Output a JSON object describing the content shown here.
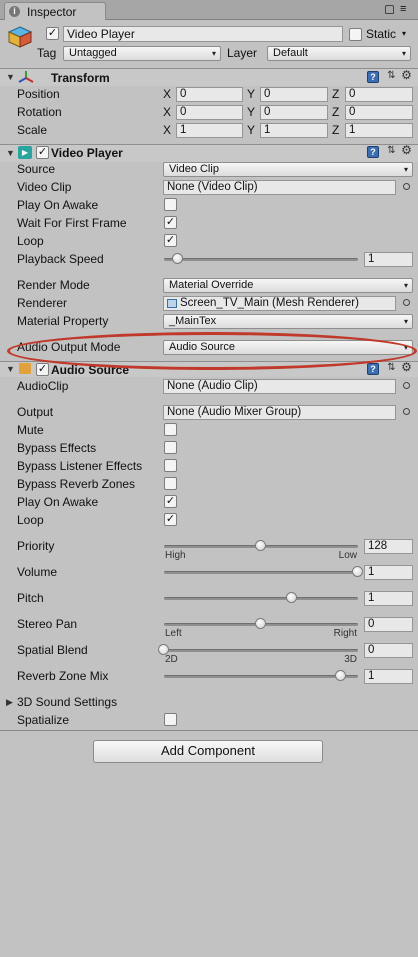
{
  "window": {
    "tab_label": "Inspector",
    "lock_icon": "lock-icon",
    "menu_icon": "menu-icon"
  },
  "object": {
    "name": "Video Player",
    "static_label": "Static",
    "tag_label": "Tag",
    "tag_value": "Untagged",
    "layer_label": "Layer",
    "layer_value": "Default"
  },
  "transform": {
    "title": "Transform",
    "rows": [
      {
        "label": "Position",
        "x": "0",
        "y": "0",
        "z": "0"
      },
      {
        "label": "Rotation",
        "x": "0",
        "y": "0",
        "z": "0"
      },
      {
        "label": "Scale",
        "x": "1",
        "y": "1",
        "z": "1"
      }
    ],
    "axis": {
      "x": "X",
      "y": "Y",
      "z": "Z"
    }
  },
  "video_player": {
    "title": "Video Player",
    "source_label": "Source",
    "source_value": "Video Clip",
    "video_clip_label": "Video Clip",
    "video_clip_value": "None (Video Clip)",
    "play_on_awake_label": "Play On Awake",
    "play_on_awake": false,
    "wait_label": "Wait For First Frame",
    "wait": true,
    "loop_label": "Loop",
    "loop": true,
    "speed_label": "Playback Speed",
    "speed_value": "1",
    "speed_level": 0.07,
    "render_mode_label": "Render Mode",
    "render_mode_value": "Material Override",
    "renderer_label": "Renderer",
    "renderer_value": "Screen_TV_Main (Mesh Renderer)",
    "material_property_label": "Material Property",
    "material_property_value": "_MainTex",
    "audio_output_label": "Audio Output Mode",
    "audio_output_value": "Audio Source"
  },
  "audio_source": {
    "title": "Audio Source",
    "clip_label": "AudioClip",
    "clip_value": "None (Audio Clip)",
    "output_label": "Output",
    "output_value": "None (Audio Mixer Group)",
    "mute_label": "Mute",
    "mute": false,
    "bypass_effects_label": "Bypass Effects",
    "bypass_effects": false,
    "bypass_listener_label": "Bypass Listener Effects",
    "bypass_listener": false,
    "bypass_reverb_label": "Bypass Reverb Zones",
    "bypass_reverb": false,
    "play_on_awake_label": "Play On Awake",
    "play_on_awake": true,
    "loop_label": "Loop",
    "loop": true,
    "priority_label": "Priority",
    "priority_value": "128",
    "priority_level": 0.5,
    "priority_min": "High",
    "priority_max": "Low",
    "volume_label": "Volume",
    "volume_value": "1",
    "volume_level": 1.0,
    "pitch_label": "Pitch",
    "pitch_value": "1",
    "pitch_level": 0.66,
    "stereo_label": "Stereo Pan",
    "stereo_value": "0",
    "stereo_level": 0.5,
    "stereo_min": "Left",
    "stereo_max": "Right",
    "spatial_label": "Spatial Blend",
    "spatial_value": "0",
    "spatial_level": 0.0,
    "spatial_min": "2D",
    "spatial_max": "3D",
    "reverb_mix_label": "Reverb Zone Mix",
    "reverb_mix_value": "1",
    "reverb_mix_level": 0.91,
    "sound_settings_label": "3D Sound Settings",
    "spatialize_label": "Spatialize",
    "spatialize": false
  },
  "add_component_label": "Add Component",
  "colors": {
    "highlight": "#c0392b",
    "accent": "#3a6fb5"
  }
}
